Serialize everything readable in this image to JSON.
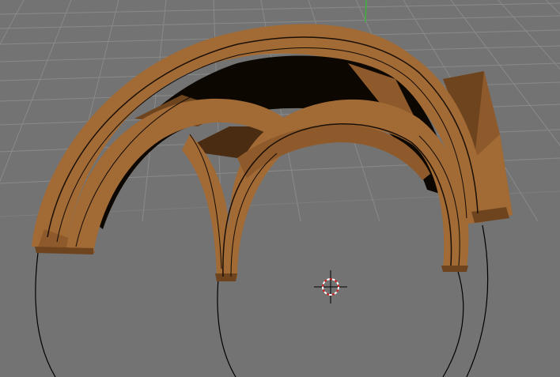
{
  "viewport": {
    "background_color": "#737373",
    "grid_color": "#8a8a8a",
    "axis_green_color": "#3cb43c",
    "wood_color": "#a26a35",
    "cursor_red": "#d22020",
    "cursor_white": "#ffffff"
  }
}
